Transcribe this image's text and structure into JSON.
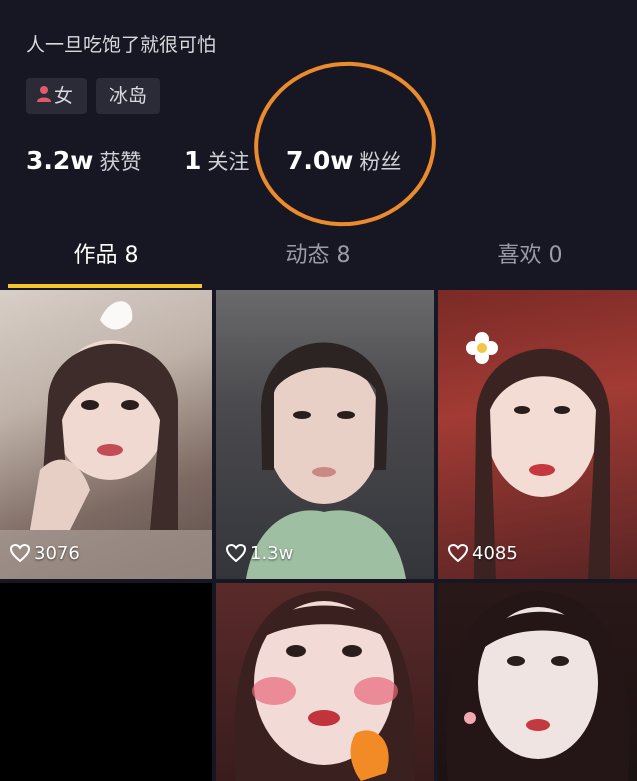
{
  "profile": {
    "bio": "人一旦吃饱了就很可怕",
    "tags": {
      "gender": "女",
      "location": "冰岛"
    },
    "stats": [
      {
        "num": "3.2w",
        "label": "获赞"
      },
      {
        "num": "1",
        "label": "关注"
      },
      {
        "num": "7.0w",
        "label": "粉丝"
      }
    ]
  },
  "tabs": [
    {
      "label": "作品 8"
    },
    {
      "label": "动态 8"
    },
    {
      "label": "喜欢 0"
    }
  ],
  "grid": {
    "videos": [
      {
        "likes": "3076"
      },
      {
        "likes": "1.3w"
      },
      {
        "likes": "4085"
      },
      {
        "likes": ""
      },
      {
        "likes": ""
      },
      {
        "likes": ""
      }
    ]
  },
  "colors": {
    "background": "#161722",
    "tab_underline": "#f5c52b",
    "annotation_circle": "#ec8b2c",
    "tag_bg": "#2a2b36"
  }
}
